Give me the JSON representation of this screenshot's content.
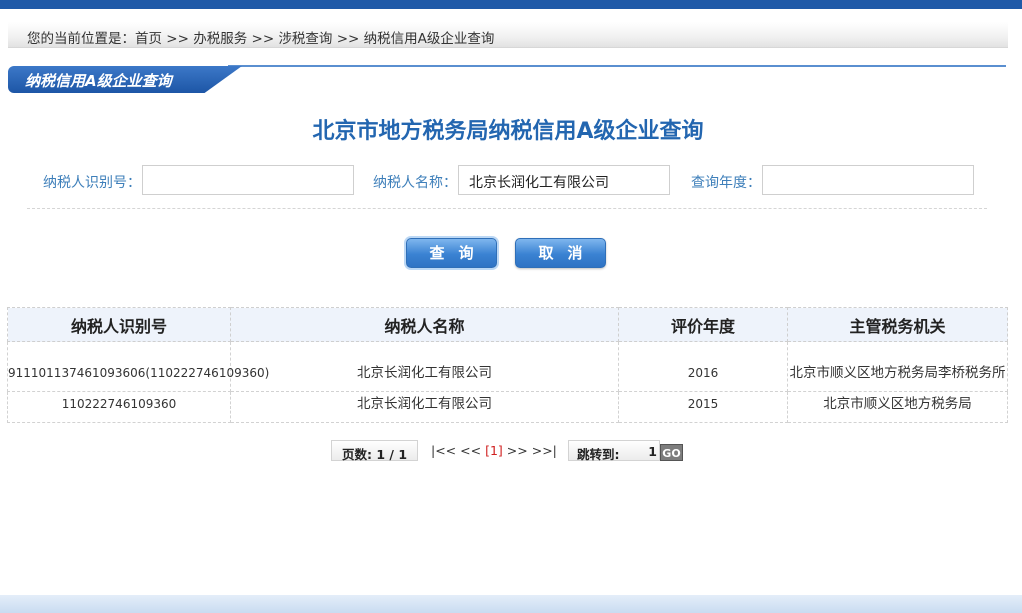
{
  "breadcrumb": {
    "prefix": "您的当前位置是：",
    "items": [
      "首页",
      "办税服务",
      "涉税查询",
      "纳税信用A级企业查询"
    ],
    "separator": " >> "
  },
  "section": {
    "tab_label": "纳税信用A级企业查询"
  },
  "page_title": "北京市地方税务局纳税信用A级企业查询",
  "form": {
    "id_label": "纳税人识别号：",
    "id_value": "",
    "name_label": "纳税人名称：",
    "name_value": "北京长润化工有限公司",
    "year_label": "查询年度：",
    "year_value": ""
  },
  "buttons": {
    "query": "查询",
    "cancel": "取消"
  },
  "table": {
    "headers": [
      "纳税人识别号",
      "纳税人名称",
      "评价年度",
      "主管税务机关"
    ],
    "rows": [
      [
        "911101137461093606(110222746109360)",
        "北京长润化工有限公司",
        "2016",
        "北京市顺义区地方税务局李桥税务所"
      ],
      [
        "110222746109360",
        "北京长润化工有限公司",
        "2015",
        "北京市顺义区地方税务局"
      ]
    ]
  },
  "pager": {
    "page_label": "页数:",
    "page_value": "1 / 1",
    "first": "|<<",
    "prev": "<<",
    "current": "[1]",
    "next": ">>",
    "last": ">>|",
    "jump_label": "跳转到:",
    "jump_value": "1",
    "go": "GO"
  },
  "colors": {
    "top_bar": "#1f5aa8",
    "title": "#2366b0",
    "label": "#3e7fba",
    "current_page": "#d02020"
  }
}
